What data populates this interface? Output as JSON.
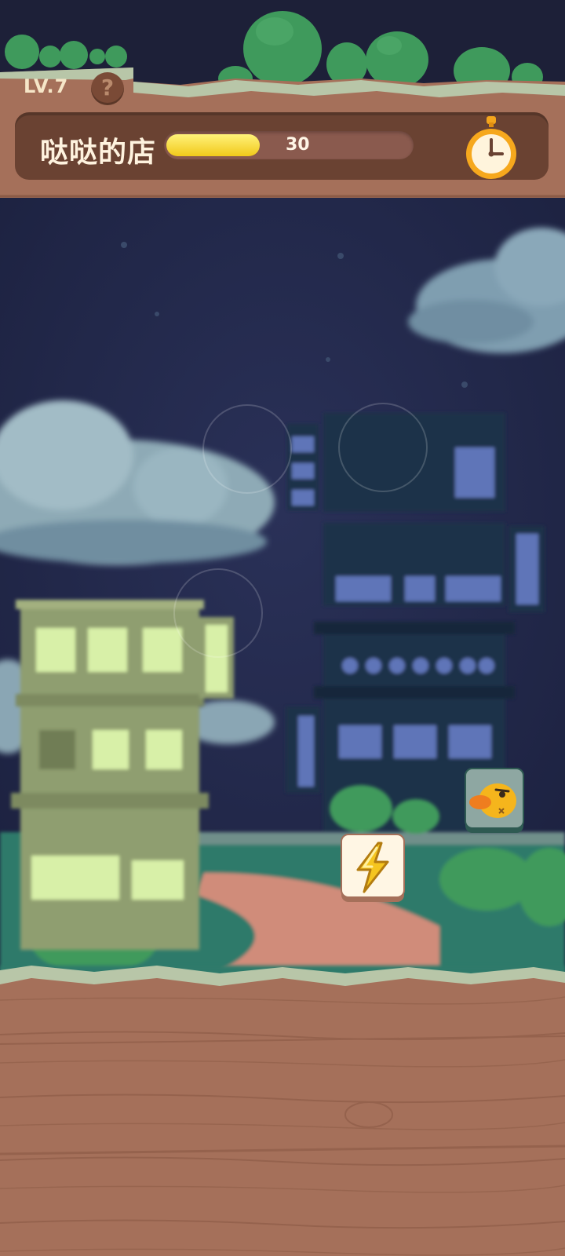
{
  "header": {
    "level": "LV.7",
    "help_symbol": "?",
    "shop_name": "哒哒的店",
    "progress_value": "30",
    "progress_fraction": 0.38,
    "timer_icon": "stopwatch-icon"
  },
  "board": {
    "tiles": [
      {
        "name": "energy-tile",
        "icon": "lightning-icon"
      },
      {
        "name": "duck-tile",
        "icon": "duck-icon"
      }
    ]
  },
  "colors": {
    "wood": "#a5705a",
    "panel": "#6a4232",
    "progress": "#f5d52a",
    "night_sky": "#24294a"
  }
}
